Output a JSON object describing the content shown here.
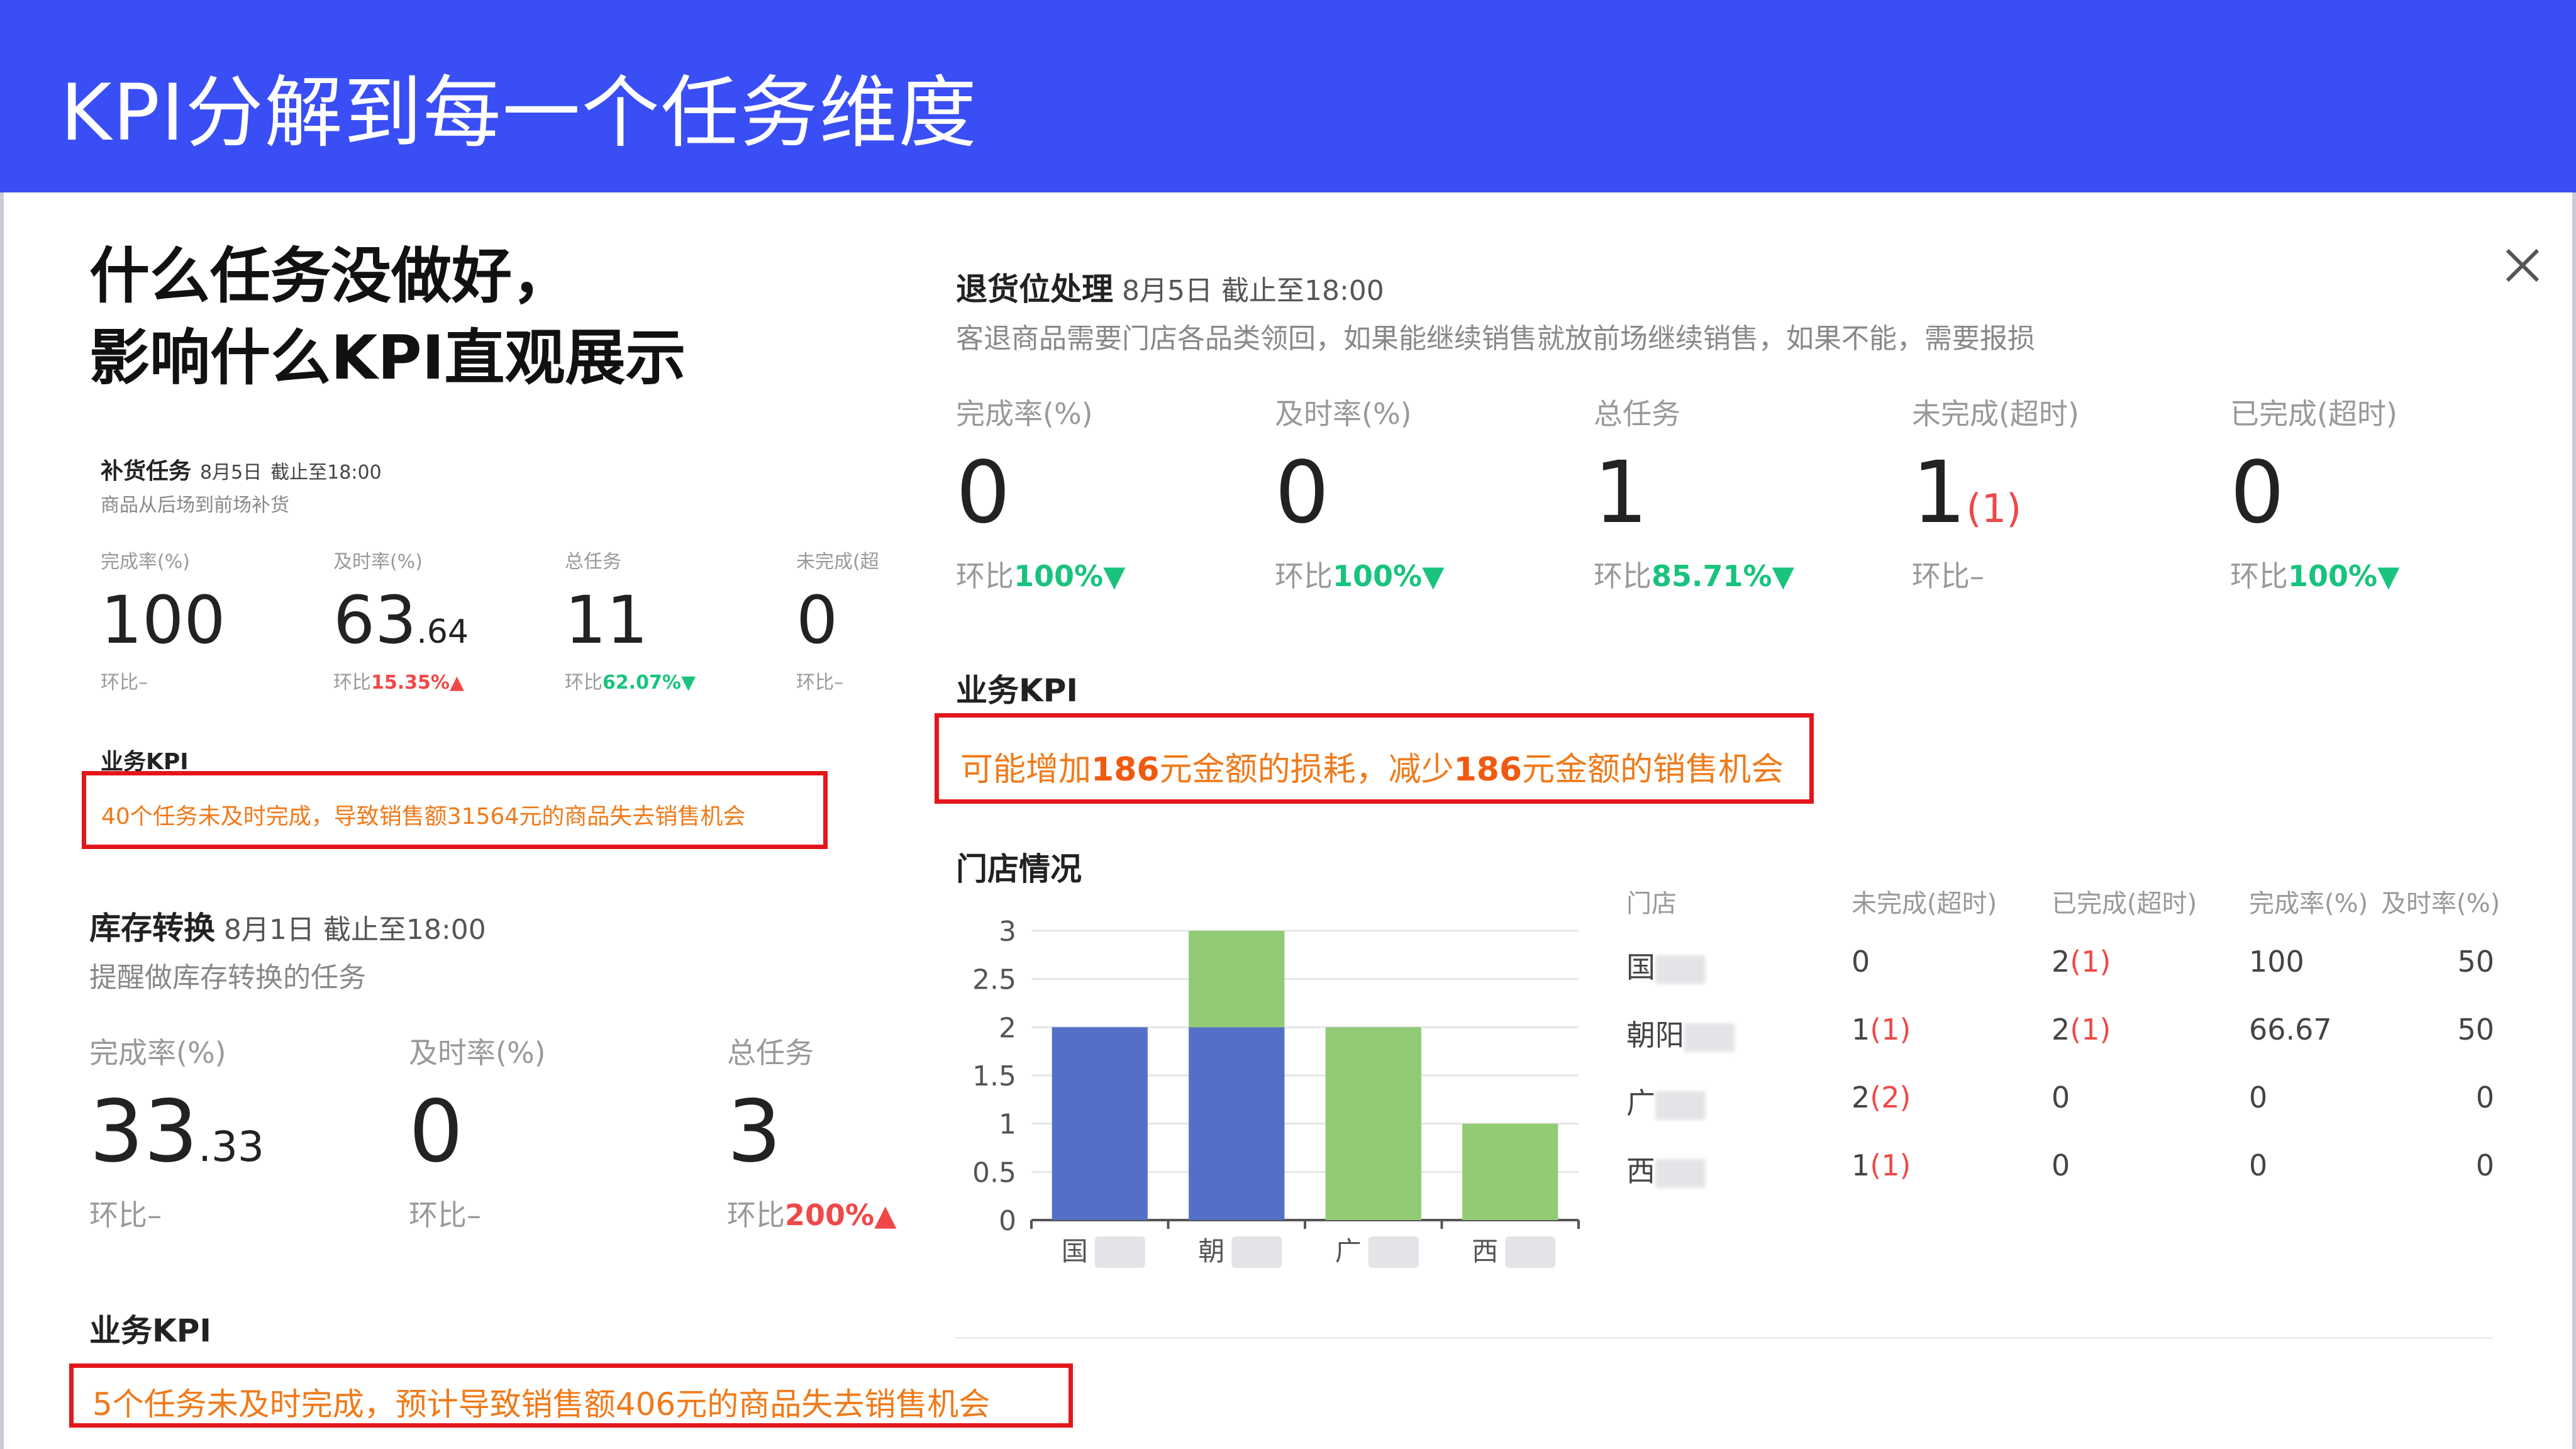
{
  "header": {
    "title": "KPI分解到每一个任务维度"
  },
  "headline": {
    "line1": "什么任务没做好，",
    "line2": "影响什么KPI直观展示"
  },
  "restock": {
    "title": "补货任务",
    "date": "8月5日",
    "deadline": "截止至18:00",
    "desc": "商品从后场到前场补货",
    "metrics": [
      {
        "label": "完成率(%)",
        "value": "100",
        "decimal": "",
        "cmp_prefix": "环比",
        "cmp": "–",
        "trend": ""
      },
      {
        "label": "及时率(%)",
        "value": "63",
        "decimal": ".64",
        "cmp_prefix": "环比",
        "cmp": "15.35%",
        "trend": "up"
      },
      {
        "label": "总任务",
        "value": "11",
        "decimal": "",
        "cmp_prefix": "环比",
        "cmp": "62.07%",
        "trend": "down"
      },
      {
        "label": "未完成(超",
        "value": "0",
        "decimal": "",
        "cmp_prefix": "环比",
        "cmp": "–",
        "trend": ""
      }
    ],
    "kpi_label": "业务KPI",
    "kpi_text": "40个任务未及时完成，导致销售额31564元的商品失去销售机会"
  },
  "inventory": {
    "title": "库存转换",
    "date": "8月1日",
    "deadline": "截止至18:00",
    "desc": "提醒做库存转换的任务",
    "metrics": [
      {
        "label": "完成率(%)",
        "value": "33",
        "decimal": ".33",
        "cmp_prefix": "环比",
        "cmp": "–",
        "trend": ""
      },
      {
        "label": "及时率(%)",
        "value": "0",
        "decimal": "",
        "cmp_prefix": "环比",
        "cmp": "–",
        "trend": ""
      },
      {
        "label": "总任务",
        "value": "3",
        "decimal": "",
        "cmp_prefix": "环比",
        "cmp": "200%",
        "trend": "up"
      }
    ],
    "kpi_label": "业务KPI",
    "kpi_text": "5个任务未及时完成，预计导致销售额406元的商品失去销售机会"
  },
  "returns": {
    "title": "退货位处理",
    "date": "8月5日",
    "deadline": "截止至18:00",
    "desc": "客退商品需要门店各品类领回，如果能继续销售就放前场继续销售，如果不能，需要报损",
    "metrics": [
      {
        "label": "完成率(%)",
        "value": "0",
        "sub": "",
        "cmp_prefix": "环比",
        "cmp": "100%",
        "trend": "down"
      },
      {
        "label": "及时率(%)",
        "value": "0",
        "sub": "",
        "cmp_prefix": "环比",
        "cmp": "100%",
        "trend": "down"
      },
      {
        "label": "总任务",
        "value": "1",
        "sub": "",
        "cmp_prefix": "环比",
        "cmp": "85.71%",
        "trend": "down"
      },
      {
        "label": "未完成(超时)",
        "value": "1",
        "sub": "(1)",
        "cmp_prefix": "环比",
        "cmp": "–",
        "trend": ""
      },
      {
        "label": "已完成(超时)",
        "value": "0",
        "sub": "",
        "cmp_prefix": "环比",
        "cmp": "100%",
        "trend": "down"
      }
    ],
    "kpi_label": "业务KPI",
    "kpi_text_1": "可能增加",
    "kpi_amount_1": "186",
    "kpi_text_2": "元金额的损耗，减少",
    "kpi_amount_2": "186",
    "kpi_text_3": "元金额的销售机会"
  },
  "stores": {
    "title": "门店情况",
    "columns": [
      "门店",
      "未完成(超时)",
      "已完成(超时)",
      "完成率(%)",
      "及时率(%)"
    ],
    "rows": [
      {
        "store": "国",
        "unfinished": "0",
        "unfinished_sub": "",
        "finished": "2",
        "finished_sub": "(1)",
        "rate": "100",
        "timely": "50"
      },
      {
        "store": "朝阳",
        "unfinished": "1",
        "unfinished_sub": "(1)",
        "finished": "2",
        "finished_sub": "(1)",
        "rate": "66.67",
        "timely": "50"
      },
      {
        "store": "广",
        "unfinished": "2",
        "unfinished_sub": "(2)",
        "finished": "0",
        "finished_sub": "",
        "rate": "0",
        "timely": "0"
      },
      {
        "store": "西",
        "unfinished": "1",
        "unfinished_sub": "(1)",
        "finished": "0",
        "finished_sub": "",
        "rate": "0",
        "timely": "0"
      }
    ]
  },
  "chart_data": {
    "type": "bar",
    "stacked": true,
    "categories": [
      "国",
      "朝",
      "广",
      "西"
    ],
    "series": [
      {
        "color": "#5470c6",
        "values": [
          2,
          2,
          0,
          0
        ]
      },
      {
        "color": "#91cc75",
        "values": [
          0,
          1,
          2,
          1
        ]
      }
    ],
    "ylim": [
      0,
      3
    ],
    "yticks": [
      "0",
      "0.5",
      "1",
      "1.5",
      "2",
      "2.5",
      "3"
    ],
    "grid": true
  },
  "colors": {
    "header": "#3a4ef5",
    "kpi_border": "#e3161b",
    "kpi_text": "#f07a1a",
    "up": "#f04848",
    "down": "#19c37d"
  }
}
